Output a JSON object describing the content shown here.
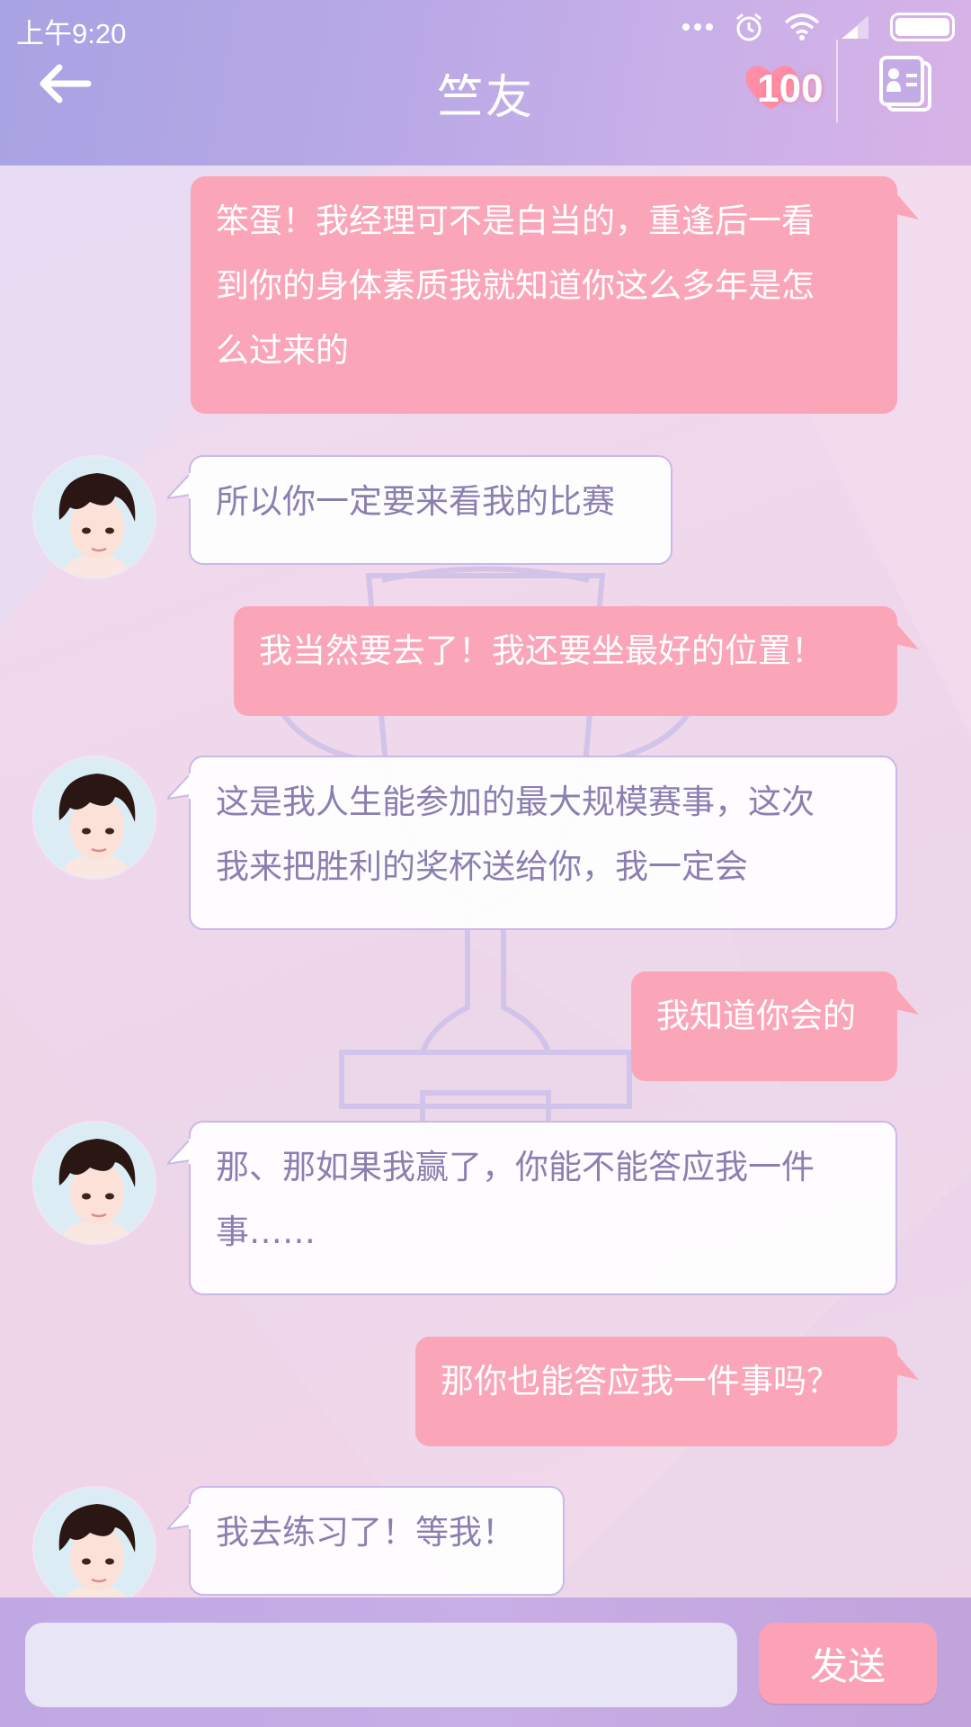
{
  "status_bar": {
    "time": "上午9:20",
    "icons": [
      "more-dots-icon",
      "alarm-icon",
      "wifi-icon",
      "signal-icon",
      "battery-icon"
    ]
  },
  "header": {
    "title": "竺友",
    "affinity_value": "100",
    "icons": [
      "back-arrow-icon",
      "heart-icon",
      "profile-card-icon"
    ]
  },
  "messages": [
    {
      "sender": "me",
      "text_lines": [
        "笨蛋！我经理可不是白当的，重逢后一看",
        "到你的身体素质我就知道你这么多年是怎",
        "么过来的"
      ]
    },
    {
      "sender": "him",
      "text_lines": [
        "所以你一定要来看我的比赛"
      ]
    },
    {
      "sender": "me",
      "text_lines": [
        "我当然要去了！我还要坐最好的位置！"
      ]
    },
    {
      "sender": "him",
      "text_lines": [
        "这是我人生能参加的最大规模赛事，这次",
        "我来把胜利的奖杯送给你，我一定会"
      ]
    },
    {
      "sender": "me",
      "text_lines": [
        "我知道你会的"
      ]
    },
    {
      "sender": "him",
      "text_lines": [
        "那、那如果我赢了，你能不能答应我一件",
        "事……"
      ]
    },
    {
      "sender": "me",
      "text_lines": [
        "那你也能答应我一件事吗？"
      ]
    },
    {
      "sender": "him",
      "text_lines": [
        "我去练习了！等我！"
      ]
    }
  ],
  "input_bar": {
    "input_value": "",
    "send_label": "发送"
  },
  "colors": {
    "header_gradient_start": "#a8a3e3",
    "my_bubble": "#fba5b8",
    "his_bubble_text": "#8b7fb1",
    "send_button": "#fba2b7"
  }
}
